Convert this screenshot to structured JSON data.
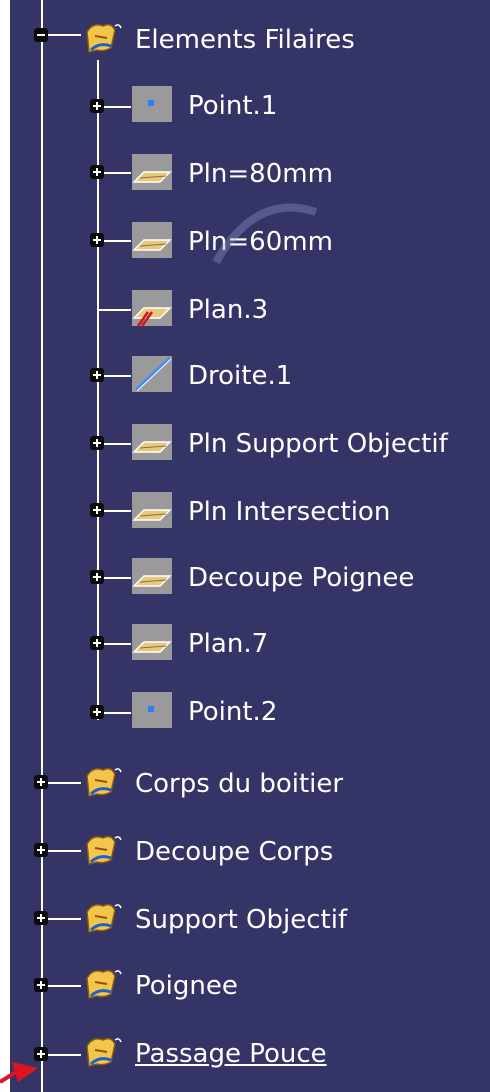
{
  "tree": {
    "root_open": {
      "label": "Elements Filaires",
      "icon": "geometrical-set-icon",
      "children": [
        {
          "label": "Point.1",
          "icon": "point-icon"
        },
        {
          "label": "Pln=80mm",
          "icon": "plane-icon"
        },
        {
          "label": "Pln=60mm",
          "icon": "plane-icon"
        },
        {
          "label": "Plan.3",
          "icon": "plane-hidden-icon"
        },
        {
          "label": "Droite.1",
          "icon": "line-icon"
        },
        {
          "label": "Pln Support Objectif",
          "icon": "plane-icon"
        },
        {
          "label": "Pln Intersection",
          "icon": "plane-icon"
        },
        {
          "label": "Decoupe Poignee",
          "icon": "plane-icon"
        },
        {
          "label": "Plan.7",
          "icon": "plane-icon"
        },
        {
          "label": "Point.2",
          "icon": "point-icon"
        }
      ]
    },
    "siblings": [
      {
        "label": "Corps du boitier",
        "icon": "geometrical-set-icon"
      },
      {
        "label": "Decoupe Corps",
        "icon": "geometrical-set-icon"
      },
      {
        "label": "Support Objectif",
        "icon": "geometrical-set-icon"
      },
      {
        "label": "Poignee",
        "icon": "geometrical-set-icon"
      },
      {
        "label": "Passage Pouce",
        "icon": "geometrical-set-icon",
        "selected": true
      }
    ]
  },
  "colors": {
    "background": "#343466",
    "tree_lines": "#ffffff",
    "text": "#ffffff",
    "pointer_arrow": "#e0141e"
  }
}
